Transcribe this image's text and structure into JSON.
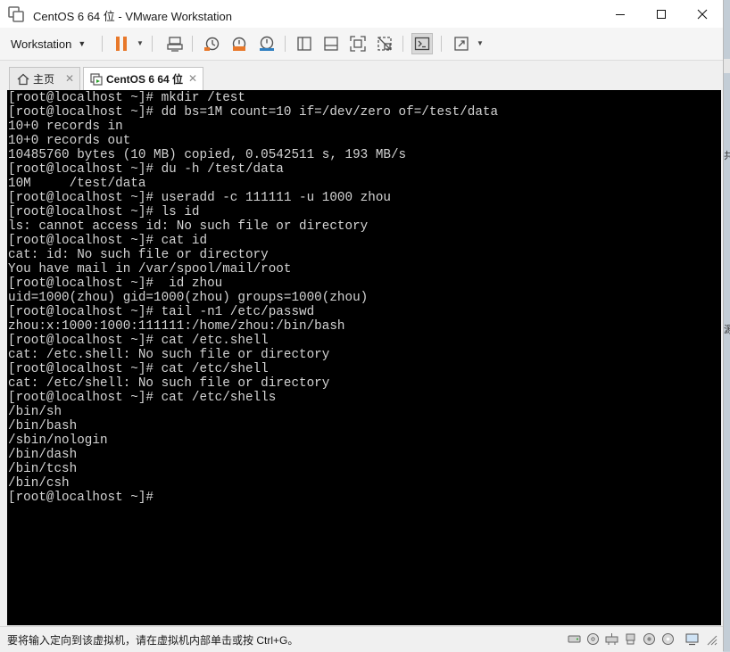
{
  "window": {
    "title": "CentOS 6 64 位 - VMware Workstation"
  },
  "caption_buttons": [
    {
      "name": "minimize-icon"
    },
    {
      "name": "maximize-icon"
    },
    {
      "name": "close-icon"
    }
  ],
  "toolbar": {
    "workstation_label": "Workstation",
    "icons": [
      "pause-icon",
      "send-ctrl-alt-del-icon",
      "snapshot-icon",
      "revert-snapshot-icon",
      "snapshot-manager-icon",
      "show-library-icon",
      "thumbnail-bar-icon",
      "full-screen-icon",
      "unity-icon",
      "console-view-icon",
      "stretch-guest-icon"
    ]
  },
  "tabs": [
    {
      "label": "主页",
      "active": false
    },
    {
      "label": "CentOS 6 64 位",
      "active": true
    }
  ],
  "terminal": {
    "lines": [
      "[root@localhost ~]# mkdir /test",
      "[root@localhost ~]# dd bs=1M count=10 if=/dev/zero of=/test/data",
      "10+0 records in",
      "10+0 records out",
      "10485760 bytes (10 MB) copied, 0.0542511 s, 193 MB/s",
      "[root@localhost ~]# du -h /test/data",
      "10M     /test/data",
      "[root@localhost ~]# useradd -c 111111 -u 1000 zhou",
      "[root@localhost ~]# ls id",
      "ls: cannot access id: No such file or directory",
      "[root@localhost ~]# cat id",
      "cat: id: No such file or directory",
      "You have mail in /var/spool/mail/root",
      "[root@localhost ~]#  id zhou",
      "uid=1000(zhou) gid=1000(zhou) groups=1000(zhou)",
      "[root@localhost ~]# tail -n1 /etc/passwd",
      "zhou:x:1000:1000:111111:/home/zhou:/bin/bash",
      "[root@localhost ~]# cat /etc.shell",
      "cat: /etc.shell: No such file or directory",
      "[root@localhost ~]# cat /etc/shell",
      "cat: /etc/shell: No such file or directory",
      "[root@localhost ~]# cat /etc/shells",
      "/bin/sh",
      "/bin/bash",
      "/sbin/nologin",
      "/bin/dash",
      "/bin/tcsh",
      "/bin/csh",
      "[root@localhost ~]#"
    ]
  },
  "status": {
    "text": "要将输入定向到该虚拟机，请在虚拟机内部单击或按 Ctrl+G。",
    "icons": [
      "hard-disk-icon",
      "cd-rom-icon",
      "network-adapter-icon",
      "usb-controller-icon",
      "sound-card-icon",
      "printer-icon",
      "display-icon",
      "resize-grip-icon"
    ]
  },
  "desktop_edge": {
    "text_1": "共",
    "text_2": "源"
  },
  "colors": {
    "accent_orange": "#e8782a",
    "terminal_bg": "#000000",
    "terminal_fg": "#d4d4d4"
  }
}
